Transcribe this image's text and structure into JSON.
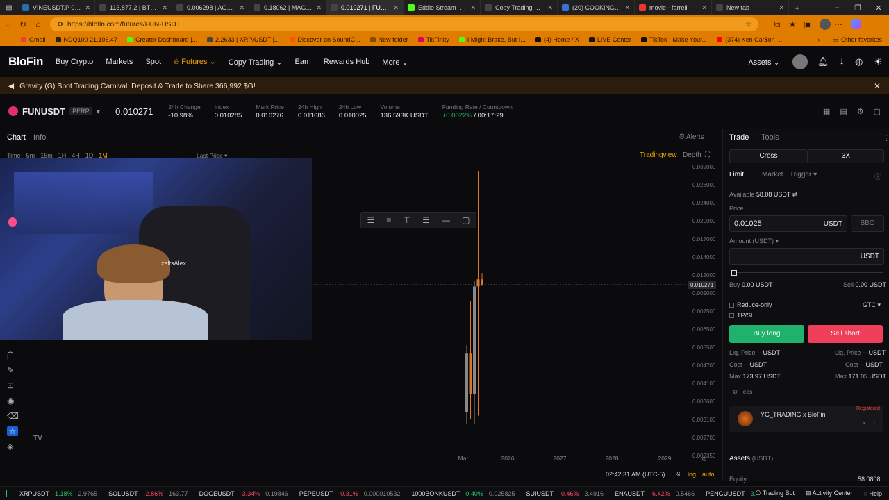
{
  "browser": {
    "tabs": [
      {
        "label": "VINEUSDT.P 0.0944",
        "color": "#2b6cb0"
      },
      {
        "label": "113,877.2 | BTC/USD",
        "color": "#444"
      },
      {
        "label": "0.006298 | AGT/USD",
        "color": "#444"
      },
      {
        "label": "0.18062 | MAGIC/U",
        "color": "#444"
      },
      {
        "label": "0.010271 | FUN/US",
        "color": "#444",
        "active": true
      },
      {
        "label": "Eddie Stream - Wa",
        "color": "#53fc18"
      },
      {
        "label": "Copy Trading Deta",
        "color": "#444"
      },
      {
        "label": "(20) COOKING - W",
        "color": "#3a6fd8"
      },
      {
        "label": "movie - farrell",
        "color": "#e33"
      },
      {
        "label": "New tab",
        "color": "#444"
      }
    ],
    "url": "https://blofin.com/futures/FUN-USDT",
    "bookmarks": [
      {
        "label": "Gmail",
        "color": "#ea4335"
      },
      {
        "label": "NDQ100 21,106.47",
        "color": "#222"
      },
      {
        "label": "Creator Dashboard |...",
        "color": "#53fc18"
      },
      {
        "label": "2.2633 | XRP/USDT |...",
        "color": "#444"
      },
      {
        "label": "Discover on SoundC...",
        "color": "#ff5500"
      },
      {
        "label": "New folder",
        "color": "#7a5200"
      },
      {
        "label": "TikFinity",
        "color": "#e0006c"
      },
      {
        "label": "I Might Brake, But I...",
        "color": "#53fc18"
      },
      {
        "label": "(4) Home / X",
        "color": "#111"
      },
      {
        "label": "LIVE Center",
        "color": "#111"
      },
      {
        "label": "TikTok - Make Your...",
        "color": "#111"
      },
      {
        "label": "(374) Ken Car$on -...",
        "color": "#ff0000"
      }
    ],
    "other_bookmarks": "Other favorites"
  },
  "header": {
    "logo": "BloFin",
    "nav": [
      "Buy Crypto",
      "Markets",
      "Spot",
      "Futures",
      "Copy Trading",
      "Earn",
      "Rewards Hub",
      "More"
    ],
    "assets_label": "Assets"
  },
  "banner": {
    "text": "Gravity (G) Spot Trading Carnival: Deposit & Trade to Share 366,992 $G!"
  },
  "ticker": {
    "symbol": "FUNUSDT",
    "badge": "PERP",
    "price": "0.010271",
    "stats": [
      {
        "label": "24h Change",
        "value": "-10.98%",
        "tone": "red"
      },
      {
        "label": "Index",
        "value": "0.010285",
        "tone": ""
      },
      {
        "label": "Mark Price",
        "value": "0.010276",
        "tone": ""
      },
      {
        "label": "24h High",
        "value": "0.011686",
        "tone": ""
      },
      {
        "label": "24h Low",
        "value": "0.010025",
        "tone": ""
      },
      {
        "label": "Volume",
        "value": "136.593K USDT",
        "tone": ""
      }
    ],
    "funding_label": "Funding Rate / Countdown",
    "funding_rate": "+0.0022%",
    "funding_countdown": "/ 00:17:29"
  },
  "chart_tabs": {
    "chart": "Chart",
    "info": "Info",
    "alerts": "Alerts",
    "tradingview": "Tradingview",
    "depth": "Depth",
    "timeframes": [
      "Time",
      "5m",
      "15m",
      "1H",
      "4H",
      "1D",
      "1M"
    ],
    "last_price": "Last Price"
  },
  "chart_data": {
    "type": "candlestick",
    "y_ticks": [
      "0.032000",
      "0.028000",
      "0.024000",
      "0.020000",
      "0.017000",
      "0.014000",
      "0.012000",
      "0.009000",
      "0.007500",
      "0.006500",
      "0.005500",
      "0.004700",
      "0.004100",
      "0.003600",
      "0.003100",
      "0.002700",
      "0.002350"
    ],
    "x_ticks": [
      "Mar",
      "2026",
      "2027",
      "2028",
      "2029"
    ],
    "current_price_label": "0.010271",
    "candles": [
      {
        "o": 0.0033,
        "h": 0.0056,
        "l": 0.003,
        "c": 0.0052,
        "color": "#888"
      },
      {
        "o": 0.0052,
        "h": 0.0083,
        "l": 0.0031,
        "c": 0.0038,
        "color": "#d9772a"
      },
      {
        "o": 0.0038,
        "h": 0.011,
        "l": 0.003,
        "c": 0.01,
        "color": "#888"
      },
      {
        "o": 0.01,
        "h": 0.031,
        "l": 0.0032,
        "c": 0.0112,
        "color": "#d9772a"
      },
      {
        "o": 0.0112,
        "h": 0.0122,
        "l": 0.0101,
        "c": 0.0103,
        "color": "#d9772a"
      }
    ],
    "time_label": "02:42:31 AM (UTC-5)",
    "scale_options": [
      "%",
      "log",
      "auto"
    ]
  },
  "overlay": {
    "name_tag": "zeltsAlex"
  },
  "trade_panel": {
    "tabs": [
      "Trade",
      "Tools"
    ],
    "margin_mode": "Cross",
    "leverage": "3X",
    "order_types": [
      "Limit",
      "Market",
      "Trigger"
    ],
    "available_label": "Available",
    "available_value": "58.08 USDT",
    "price_label": "Price",
    "price_value": "0.01025",
    "price_unit": "USDT",
    "bbo_label": "BBO",
    "amount_label": "Amount (USDT)",
    "amount_unit": "USDT",
    "slider_fraction": 0,
    "buy_label": "Buy",
    "buy_value": "0.00 USDT",
    "sell_label": "Sell",
    "sell_value": "0.00 USDT",
    "reduce_only": "Reduce-only",
    "tpsl": "TP/SL",
    "tif": "GTC",
    "buy_long": "Buy long",
    "sell_short": "Sell short",
    "liq_label": "Liq. Price",
    "liq_value": "-- USDT",
    "cost_label": "Cost",
    "cost_value": "-- USDT",
    "max_label": "Max",
    "max_buy": "173.97 USDT",
    "max_sell": "171.05 USDT",
    "fees_label": "Fees",
    "promo_title": "YG_TRADING x BloFin",
    "promo_badge": "Registered",
    "assets_title": "Assets",
    "assets_unit": "(USDT)",
    "equity_label": "Equity",
    "equity_value": "58.0808"
  },
  "bottom_ticker": [
    {
      "sym": "XRPUSDT",
      "chg": "1.18%",
      "price": "2.9765",
      "tone": "green"
    },
    {
      "sym": "SOLUSDT",
      "chg": "-2.86%",
      "price": "163.77",
      "tone": "red"
    },
    {
      "sym": "DOGEUSDT",
      "chg": "-3.34%",
      "price": "0.19846",
      "tone": "red"
    },
    {
      "sym": "PEPEUSDT",
      "chg": "-0.31%",
      "price": "0.000010532",
      "tone": "red"
    },
    {
      "sym": "1000BONKUSDT",
      "chg": "0.40%",
      "price": "0.025825",
      "tone": "green"
    },
    {
      "sym": "SUIUSDT",
      "chg": "-0.46%",
      "price": "3.4916",
      "tone": "red"
    },
    {
      "sym": "ENAUSDT",
      "chg": "-6.42%",
      "price": "0.5466",
      "tone": "red"
    },
    {
      "sym": "PENGUUSDT",
      "chg": "3.79%",
      "price": "0.0",
      "tone": "green"
    }
  ],
  "bottom_links": [
    "Trading Bot",
    "Activity Center",
    "Help"
  ]
}
